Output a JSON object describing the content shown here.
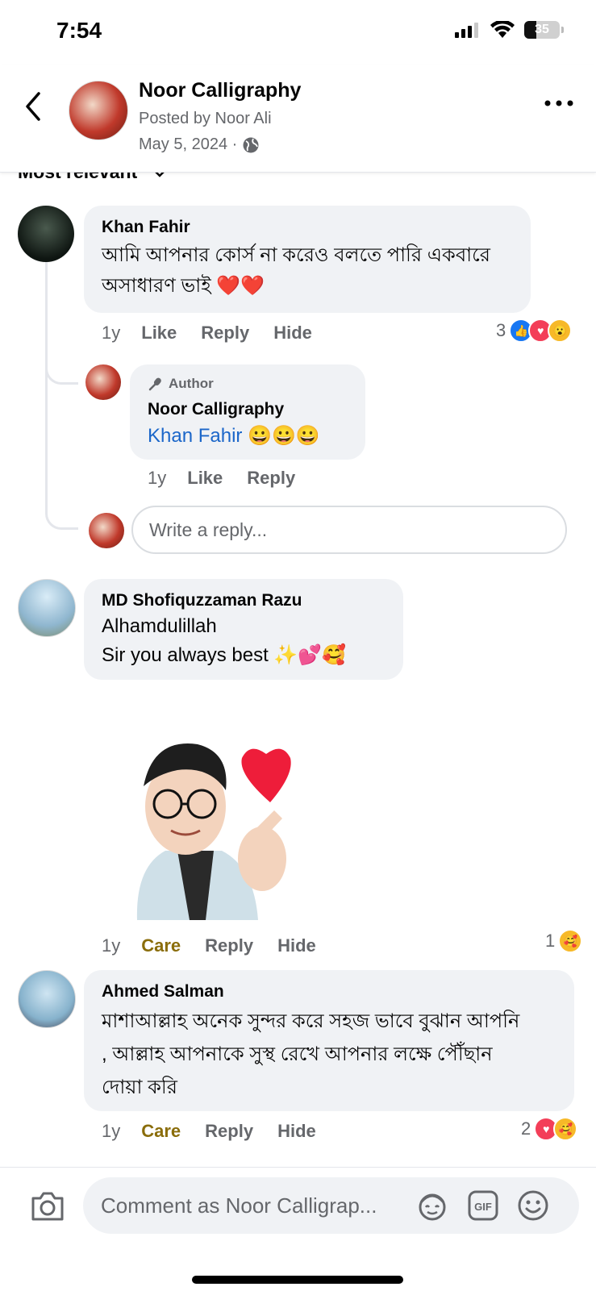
{
  "status": {
    "time": "7:54",
    "battery": "35"
  },
  "header": {
    "page_name": "Noor Calligraphy",
    "posted_by": "Posted by Noor Ali",
    "date": "May 5, 2024 ·"
  },
  "sort": {
    "label": "Most relevant"
  },
  "comments": [
    {
      "name": "Khan Fahir",
      "text_line1": "আমি আপনার কোর্স না করেও বলতে পারি একবারে",
      "text_line2": "অসাধারণ ভাই ❤️❤️",
      "age": "1y",
      "like": "Like",
      "reply": "Reply",
      "hide": "Hide",
      "reaction_count": "3",
      "reply_item": {
        "badge": "Author",
        "name": "Noor Calligraphy",
        "mention": "Khan Fahir",
        "emoji": "😀😀😀",
        "age": "1y",
        "like": "Like",
        "reply": "Reply"
      }
    },
    {
      "name": "MD Shofiquzzaman Razu",
      "text_line1": "Alhamdulillah",
      "text_line2": "Sir you always best ✨💕🥰",
      "age": "1y",
      "care": "Care",
      "reply": "Reply",
      "hide": "Hide",
      "reaction_count": "1"
    },
    {
      "name": "Ahmed Salman",
      "text_line1": "মাশাআল্লাহ অনেক সুন্দর করে সহজ ভাবে বুঝান আপনি",
      "text_line2": ", আল্লাহ আপনাকে সুস্থ রেখে আপনার লক্ষে পৌঁছান",
      "text_line3": "দোয়া করি",
      "age": "1y",
      "care": "Care",
      "reply": "Reply",
      "hide": "Hide",
      "reaction_count": "2"
    }
  ],
  "reply_input": {
    "placeholder": "Write a reply..."
  },
  "composer": {
    "placeholder": "Comment as Noor Calligrap..."
  },
  "colors": {
    "link": "#1b66c9",
    "care": "#8a6d0b",
    "like_blue": "#1877f2",
    "love_red": "#f33e58"
  }
}
